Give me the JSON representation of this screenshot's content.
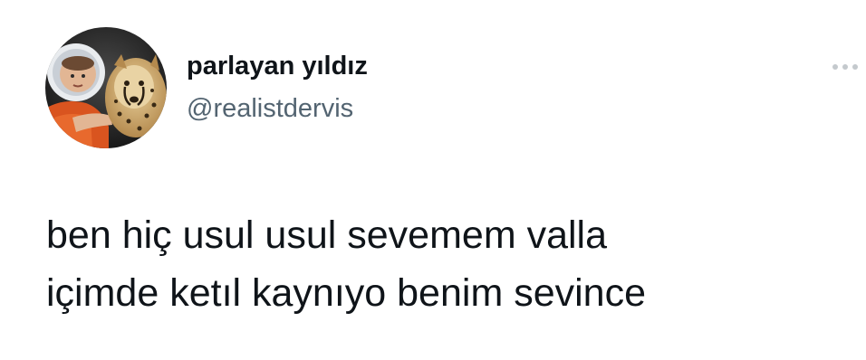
{
  "tweet": {
    "author": {
      "display_name": "parlayan yıldız",
      "handle": "@realistdervis",
      "avatar_icon": "astronaut-with-cheetah-avatar"
    },
    "more_icon": "more-horizontal-icon",
    "text_lines": [
      "ben hiç usul usul sevemem valla",
      "içimde ketıl kaynıyo benim sevince"
    ]
  },
  "colors": {
    "background": "#ffffff",
    "primary_text": "#0f1419",
    "secondary_text": "#536471",
    "more_icon": "#c4c9cd"
  }
}
